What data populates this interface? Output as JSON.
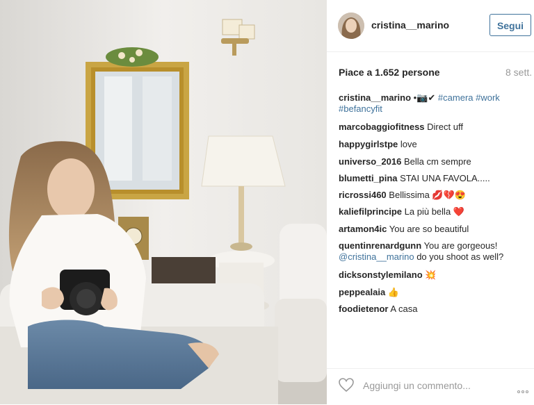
{
  "header": {
    "username": "cristina__marino",
    "follow_label": "Segui"
  },
  "post": {
    "likes": "Piace a 1.652 persone",
    "date": "8 sett."
  },
  "caption": {
    "username": "cristina__marino",
    "text": "•📷✔ ",
    "hashtags": [
      "#camera",
      "#work",
      "#befancyfit"
    ]
  },
  "comments": [
    {
      "username": "marcobaggiofitness",
      "text": "Direct uff"
    },
    {
      "username": "happygirlstpe",
      "text": "love"
    },
    {
      "username": "universo_2016",
      "text": "Bella cm sempre"
    },
    {
      "username": "blumetti_pina",
      "text": "STAI UNA FAVOLA....."
    },
    {
      "username": "ricrossi460",
      "text": "Bellissima 💋💔😍"
    },
    {
      "username": "kaliefilprincipe",
      "text": "La più bella ❤️"
    },
    {
      "username": "artamon4ic",
      "text": "You are so beautiful"
    },
    {
      "username": "quentinrenardgunn",
      "text": "You are gorgeous!",
      "mention": "@cristina__marino",
      "text2": "do you shoot as well?"
    },
    {
      "username": "dicksonstylemilano",
      "text": "💥"
    },
    {
      "username": "peppealaia",
      "text": "👍"
    },
    {
      "username": "foodietenor",
      "text": "A casa"
    }
  ],
  "comment_input": {
    "placeholder": "Aggiungi un commento..."
  },
  "icons": {
    "like": "heart-icon",
    "more": "more-options-icon",
    "verified_check_color": "#4caf50"
  },
  "colors": {
    "link": "#3f729b",
    "text": "#262626",
    "muted": "#999999"
  }
}
